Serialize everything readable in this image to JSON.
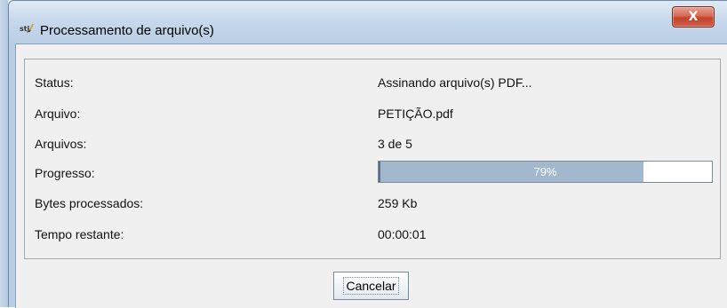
{
  "window": {
    "title": "Processamento de arquivo(s)",
    "close_label": "X",
    "icon": "stj-app-icon"
  },
  "fields": {
    "status": {
      "label": "Status:",
      "value": "Assinando arquivo(s) PDF..."
    },
    "arquivo": {
      "label": "Arquivo:",
      "value": "PETIÇÃO.pdf"
    },
    "arquivos": {
      "label": "Arquivos:",
      "value": "3 de 5"
    },
    "progresso": {
      "label": "Progresso:",
      "percent": 79,
      "text": "79%"
    },
    "bytes": {
      "label": "Bytes processados:",
      "value": "259 Kb"
    },
    "tempo": {
      "label": "Tempo restante:",
      "value": "00:00:01"
    }
  },
  "buttons": {
    "cancel_label": "Cancelar"
  },
  "colors": {
    "progress_fill": "#a3b8cc",
    "titlebar": "#c8d9ec",
    "close_button": "#c3412a"
  }
}
